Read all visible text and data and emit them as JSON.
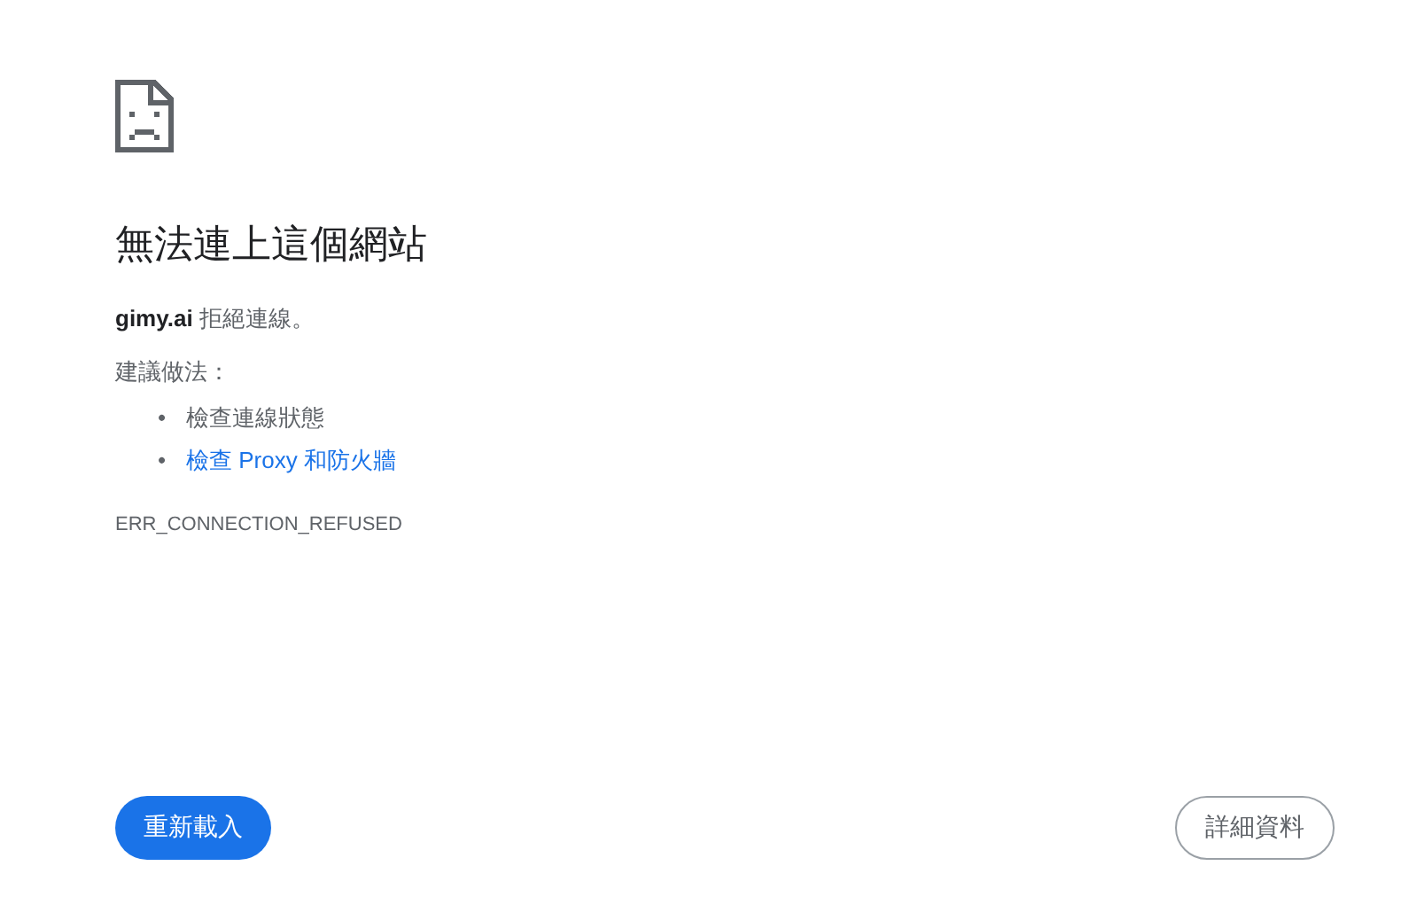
{
  "title": "無法連上這個網站",
  "message": "**gimy.ai** 拒絕連線。",
  "suggestions_heading": "建議做法：",
  "suggestions": [
    {
      "kind": "text",
      "marker": "•",
      "label": "檢查連線狀態"
    },
    {
      "kind": "link",
      "marker": "•",
      "label": "檢查 Proxy 和防火牆"
    }
  ],
  "error_code": "ERR_CONNECTION_REFUSED",
  "buttons": [
    {
      "kind": "primary",
      "label": "重新載入"
    },
    {
      "kind": "secondary",
      "label": "詳細資料"
    }
  ]
}
